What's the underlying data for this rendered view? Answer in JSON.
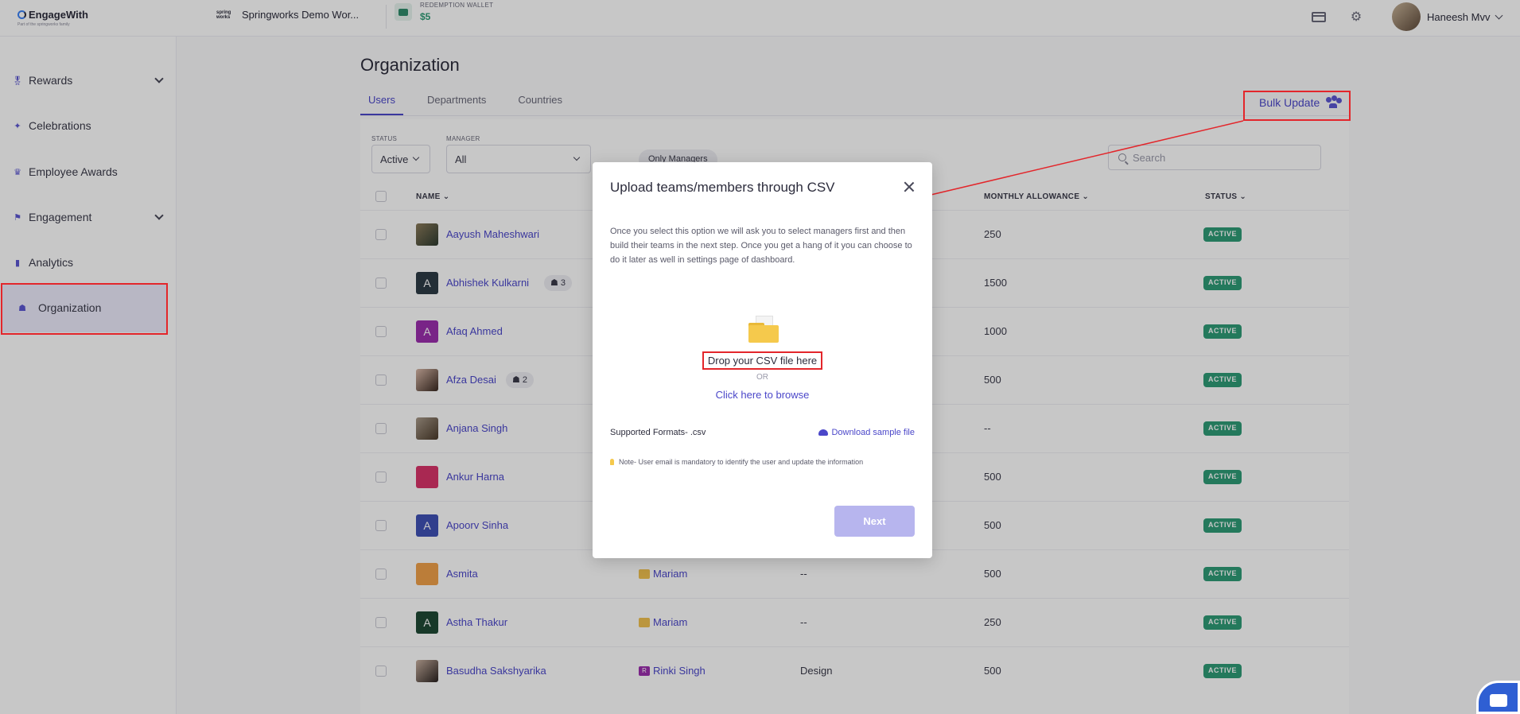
{
  "header": {
    "logo_text": "EngageWith",
    "logo_sub": "Part of the springworks family",
    "workspace_icon_text": "spring works",
    "workspace_name": "Springworks Demo Wor...",
    "wallet_label": "REDEMPTION WALLET",
    "wallet_amount": "$5",
    "user_name": "Haneesh Mvv"
  },
  "sidebar": {
    "items": [
      {
        "label": "Rewards"
      },
      {
        "label": "Celebrations"
      },
      {
        "label": "Employee Awards"
      },
      {
        "label": "Engagement"
      },
      {
        "label": "Analytics"
      },
      {
        "label": "Organization"
      }
    ]
  },
  "main": {
    "title": "Organization",
    "tabs": [
      "Users",
      "Departments",
      "Countries"
    ],
    "bulk_update": "Bulk Update",
    "filters": {
      "status_label": "STATUS",
      "status_value": "Active",
      "manager_label": "MANAGER",
      "manager_value": "All",
      "only_managers": "Only Managers",
      "search_placeholder": "Search"
    },
    "columns": {
      "name": "NAME",
      "monthly_allowance": "MONTHLY ALLOWANCE",
      "status": "STATUS"
    },
    "rows": [
      {
        "initial": "",
        "name": "Aayush Maheshwari",
        "team": "",
        "manager": "",
        "department": "",
        "allowance": "250",
        "status": "ACTIVE"
      },
      {
        "initial": "A",
        "name": "Abhishek Kulkarni",
        "team": "3",
        "manager": "",
        "department": "",
        "allowance": "1500",
        "status": "ACTIVE"
      },
      {
        "initial": "A",
        "name": "Afaq Ahmed",
        "team": "",
        "manager": "",
        "department": "",
        "allowance": "1000",
        "status": "ACTIVE"
      },
      {
        "initial": "",
        "name": "Afza Desai",
        "team": "2",
        "manager": "",
        "department": "",
        "allowance": "500",
        "status": "ACTIVE"
      },
      {
        "initial": "",
        "name": "Anjana Singh",
        "team": "",
        "manager": "",
        "department": "",
        "allowance": "--",
        "status": "ACTIVE"
      },
      {
        "initial": "",
        "name": "Ankur Harna",
        "team": "",
        "manager": "",
        "department": "",
        "allowance": "500",
        "status": "ACTIVE"
      },
      {
        "initial": "A",
        "name": "Apoorv Sinha",
        "team": "",
        "manager": "",
        "department": "",
        "allowance": "500",
        "status": "ACTIVE"
      },
      {
        "initial": "",
        "name": "Asmita",
        "team": "",
        "manager": "Mariam",
        "department": "--",
        "allowance": "500",
        "status": "ACTIVE"
      },
      {
        "initial": "A",
        "name": "Astha Thakur",
        "team": "",
        "manager": "Mariam",
        "department": "--",
        "allowance": "250",
        "status": "ACTIVE"
      },
      {
        "initial": "",
        "name": "Basudha Sakshyarika",
        "team": "",
        "manager": "Rinki Singh",
        "manager_initial": "R",
        "department": "Design",
        "allowance": "500",
        "status": "ACTIVE"
      }
    ]
  },
  "modal": {
    "title": "Upload teams/members through CSV",
    "description": "Once you select this option we will ask you to select managers first and then build their teams in the next step. Once you get a hang of it you can choose to do it later as well in settings page of dashboard.",
    "drop_text": "Drop your CSV file here",
    "or_text": "OR",
    "browse_text": "Click here to browse",
    "formats_text": "Supported Formats- .csv",
    "download_text": "Download sample file",
    "note_text": "Note- User email is mandatory to identify the user and update the information",
    "next_label": "Next"
  }
}
